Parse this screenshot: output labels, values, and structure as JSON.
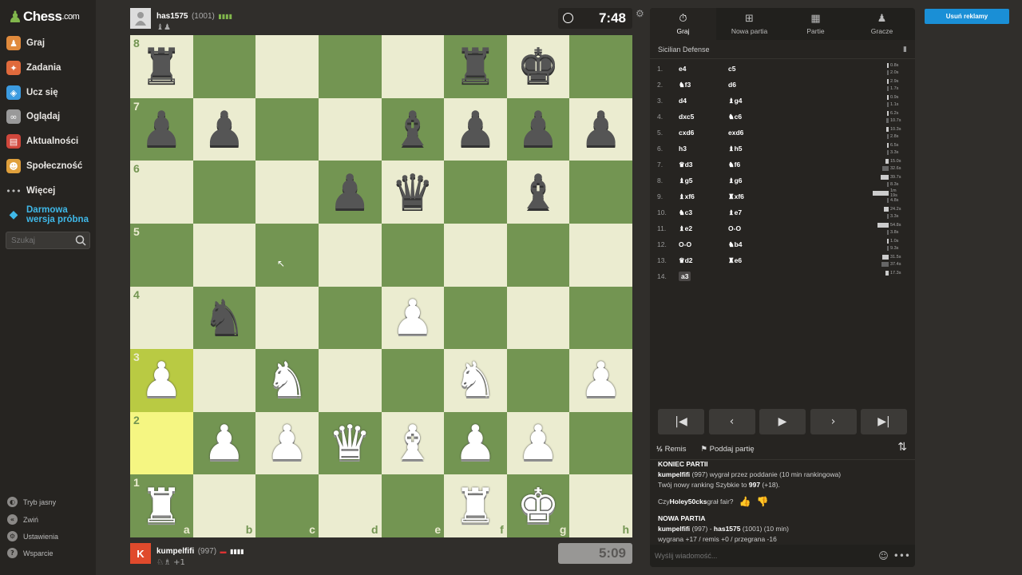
{
  "brand": {
    "logo_text": "Chess",
    "logo_suffix": ".com"
  },
  "sidebar": {
    "items": [
      {
        "label": "Graj",
        "icon": "play-icon",
        "color": "#e08a3c"
      },
      {
        "label": "Zadania",
        "icon": "puzzle-icon",
        "color": "#e06a3c"
      },
      {
        "label": "Ucz się",
        "icon": "learn-icon",
        "color": "#3c9be0"
      },
      {
        "label": "Oglądaj",
        "icon": "binoculars-icon",
        "color": "#999999"
      },
      {
        "label": "Aktualności",
        "icon": "news-icon",
        "color": "#d0473c"
      },
      {
        "label": "Społeczność",
        "icon": "community-icon",
        "color": "#e0a03c"
      },
      {
        "label": "Więcej",
        "icon": "more-icon",
        "color": "#bbbbbb"
      }
    ],
    "trial": {
      "label": "Darmowa wersja próbna",
      "icon": "diamond-icon"
    },
    "search_placeholder": "Szukaj",
    "bottom": [
      {
        "label": "Tryb jasny",
        "icon": "theme-icon"
      },
      {
        "label": "Zwiń",
        "icon": "collapse-icon"
      },
      {
        "label": "Ustawienia",
        "icon": "settings-icon"
      },
      {
        "label": "Wsparcie",
        "icon": "help-icon"
      }
    ]
  },
  "top_player": {
    "name": "has1575",
    "rating": "(1001)",
    "captured": "♝♟",
    "clock": "7:48"
  },
  "bottom_player": {
    "name": "kumpelfifi",
    "rating": "(997)",
    "captured": "♘♗",
    "advantage": "+1",
    "avatar_letter": "K",
    "clock": "5:09"
  },
  "board": {
    "rows": [
      [
        "r",
        "",
        "",
        "",
        "",
        "r",
        "k",
        ""
      ],
      [
        "p",
        "p",
        "",
        "",
        "b",
        "p",
        "p",
        "p"
      ],
      [
        "",
        "",
        "",
        "p",
        "q",
        "",
        "b",
        ""
      ],
      [
        "",
        "",
        "",
        "",
        "",
        "",
        "",
        ""
      ],
      [
        "",
        "n",
        "",
        "",
        "P",
        "",
        "",
        ""
      ],
      [
        "P",
        "",
        "N",
        "",
        "",
        "N",
        "",
        "P"
      ],
      [
        "",
        "P",
        "P",
        "Q",
        "B",
        "P",
        "P",
        ""
      ],
      [
        "R",
        "",
        "",
        "",
        "",
        "R",
        "K",
        ""
      ]
    ],
    "ranks": [
      "8",
      "7",
      "6",
      "5",
      "4",
      "3",
      "2",
      "1"
    ],
    "files": [
      "a",
      "b",
      "c",
      "d",
      "e",
      "f",
      "g",
      "h"
    ],
    "highlights": [
      "a3",
      "a2"
    ]
  },
  "panel": {
    "tabs": [
      {
        "label": "Graj",
        "icon": "stopwatch-icon"
      },
      {
        "label": "Nowa partia",
        "icon": "plus-icon"
      },
      {
        "label": "Partie",
        "icon": "board-icon"
      },
      {
        "label": "Gracze",
        "icon": "players-icon"
      }
    ],
    "opening": "Sicilian Defense",
    "moves": [
      {
        "n": "1.",
        "w": "e4",
        "b": "c5",
        "wt": "0.8s",
        "bt": "2.0s",
        "wf": 0.01,
        "bf": 0.02
      },
      {
        "n": "2.",
        "w": "♞f3",
        "b": "d6",
        "wt": "2.9s",
        "bt": "1.7s",
        "wf": 0.03,
        "bf": 0.02
      },
      {
        "n": "3.",
        "w": "d4",
        "b": "♝g4",
        "wt": "0.9s",
        "bt": "1.1s",
        "wf": 0.01,
        "bf": 0.01
      },
      {
        "n": "4.",
        "w": "dxc5",
        "b": "♞c6",
        "wt": "6.2s",
        "bt": "10.7s",
        "wf": 0.06,
        "bf": 0.1
      },
      {
        "n": "5.",
        "w": "cxd6",
        "b": "exd6",
        "wt": "10.3s",
        "bt": "2.8s",
        "wf": 0.1,
        "bf": 0.03
      },
      {
        "n": "6.",
        "w": "h3",
        "b": "♝h5",
        "wt": "6.5s",
        "bt": "3.3s",
        "wf": 0.06,
        "bf": 0.03
      },
      {
        "n": "7.",
        "w": "♛d3",
        "b": "♞f6",
        "wt": "15.0s",
        "bt": "32.6s",
        "wf": 0.14,
        "bf": 0.31
      },
      {
        "n": "8.",
        "w": "♝g5",
        "b": "♝g6",
        "wt": "39.7s",
        "bt": "8.3s",
        "wf": 0.38,
        "bf": 0.08
      },
      {
        "n": "9.",
        "w": "♝xf6",
        "b": "♜xf6",
        "wt": "1m 19s",
        "bt": "4.8s",
        "wf": 0.75,
        "bf": 0.05
      },
      {
        "n": "10.",
        "w": "♞c3",
        "b": "♝e7",
        "wt": "24.2s",
        "bt": "3.3s",
        "wf": 0.23,
        "bf": 0.03
      },
      {
        "n": "11.",
        "w": "♝e2",
        "b": "O-O",
        "wt": "54.8s",
        "bt": "3.8s",
        "wf": 0.52,
        "bf": 0.04
      },
      {
        "n": "12.",
        "w": "O-O",
        "b": "♞b4",
        "wt": "1.0s",
        "bt": "9.3s",
        "wf": 0.01,
        "bf": 0.09
      },
      {
        "n": "13.",
        "w": "♛d2",
        "b": "♜e6",
        "wt": "31.5s",
        "bt": "37.4s",
        "wf": 0.3,
        "bf": 0.36
      },
      {
        "n": "14.",
        "w": "a3",
        "b": "",
        "wt": "17.3s",
        "bt": "",
        "wf": 0.16,
        "bf": 0
      }
    ],
    "actions": {
      "draw": "Remis",
      "resign": "Poddaj partię"
    },
    "chat": {
      "end_header": "KONIEC PARTII",
      "result_winner": "kumpelfifi",
      "result_text": " (997) wygrał przez poddanie (10 min rankingowa)",
      "rating_prefix": "Twój nowy ranking Szybkie to ",
      "rating_value": "997",
      "rating_suffix": " (+18).",
      "fair_prefix": "Czy ",
      "fair_user": "Holey50cks",
      "fair_suffix": " grał fair?",
      "new_header": "NOWA PARTIA",
      "new_white": "kumpelfifi",
      "new_mid": " (997) - ",
      "new_black": "has1575",
      "new_tail": " (1001) (10 min)",
      "stats": "wygrana +17 / remis +0 / przegrana -16"
    },
    "message_placeholder": "Wyślij wiadomość..."
  },
  "ad_button": "Usuń reklamy"
}
